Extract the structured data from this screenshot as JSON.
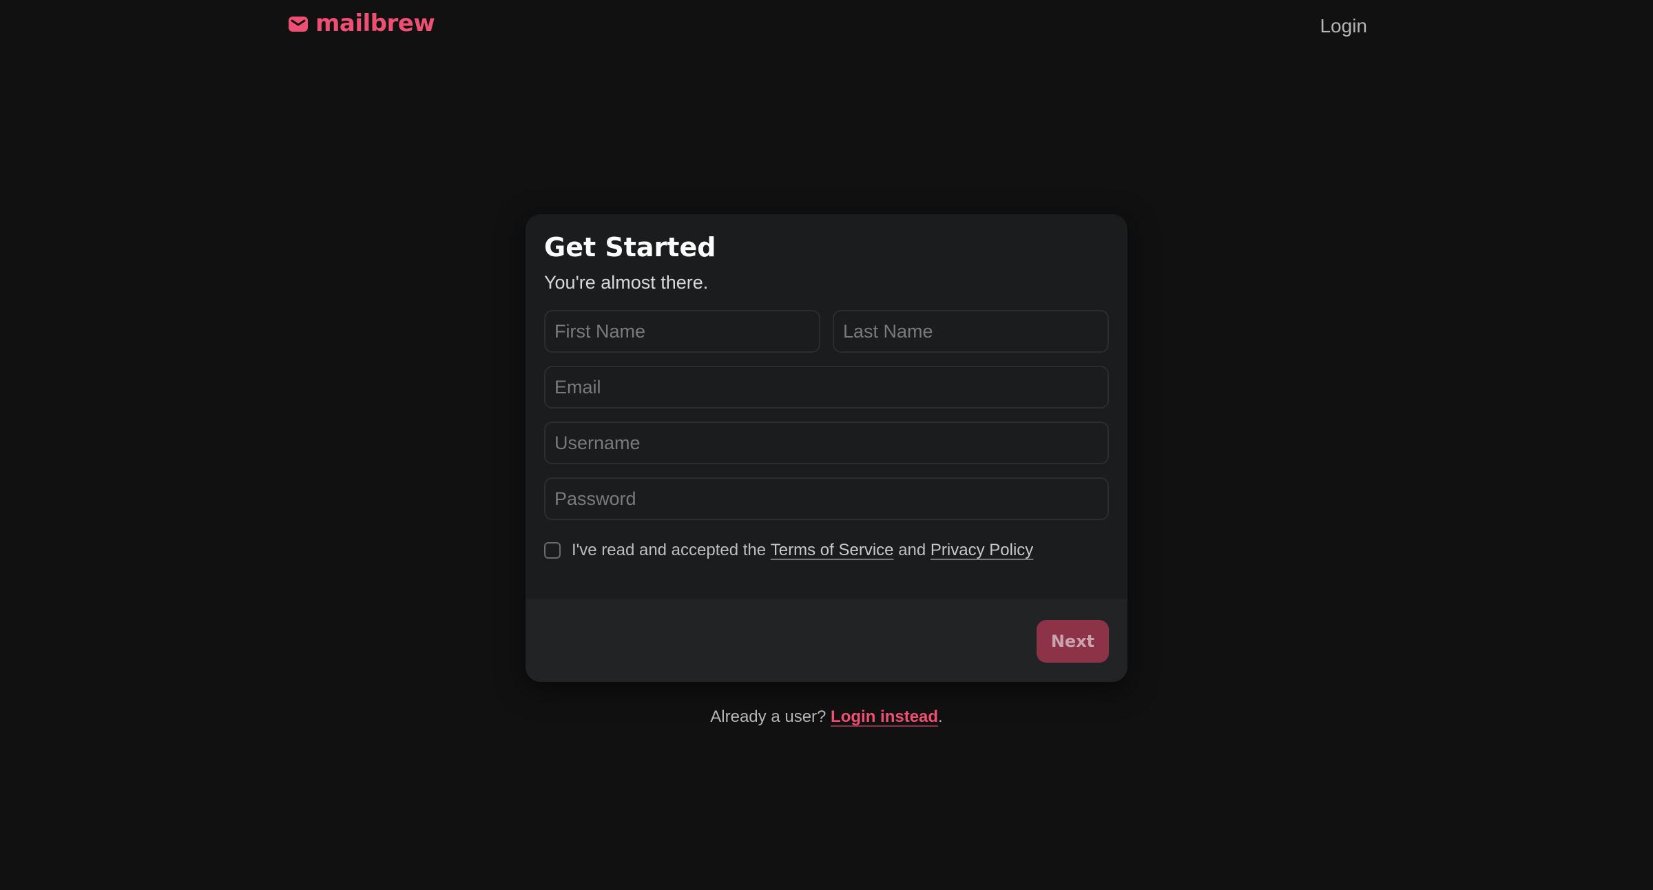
{
  "brand": {
    "name": "mailbrew",
    "icon": "envelope-icon",
    "accent_color": "#ef4f73"
  },
  "nav": {
    "login_label": "Login"
  },
  "form": {
    "title": "Get Started",
    "subtitle": "You're almost there.",
    "fields": {
      "first_name_placeholder": "First Name",
      "last_name_placeholder": "Last Name",
      "email_placeholder": "Email",
      "username_placeholder": "Username",
      "password_placeholder": "Password"
    },
    "terms": {
      "checked": false,
      "prefix": "I've read and accepted the",
      "tos_label": "Terms of Service",
      "and": "and",
      "privacy_label": "Privacy Policy"
    },
    "next_label": "Next"
  },
  "footer": {
    "prompt": "Already a user?",
    "login_link": "Login instead",
    "period": "."
  }
}
